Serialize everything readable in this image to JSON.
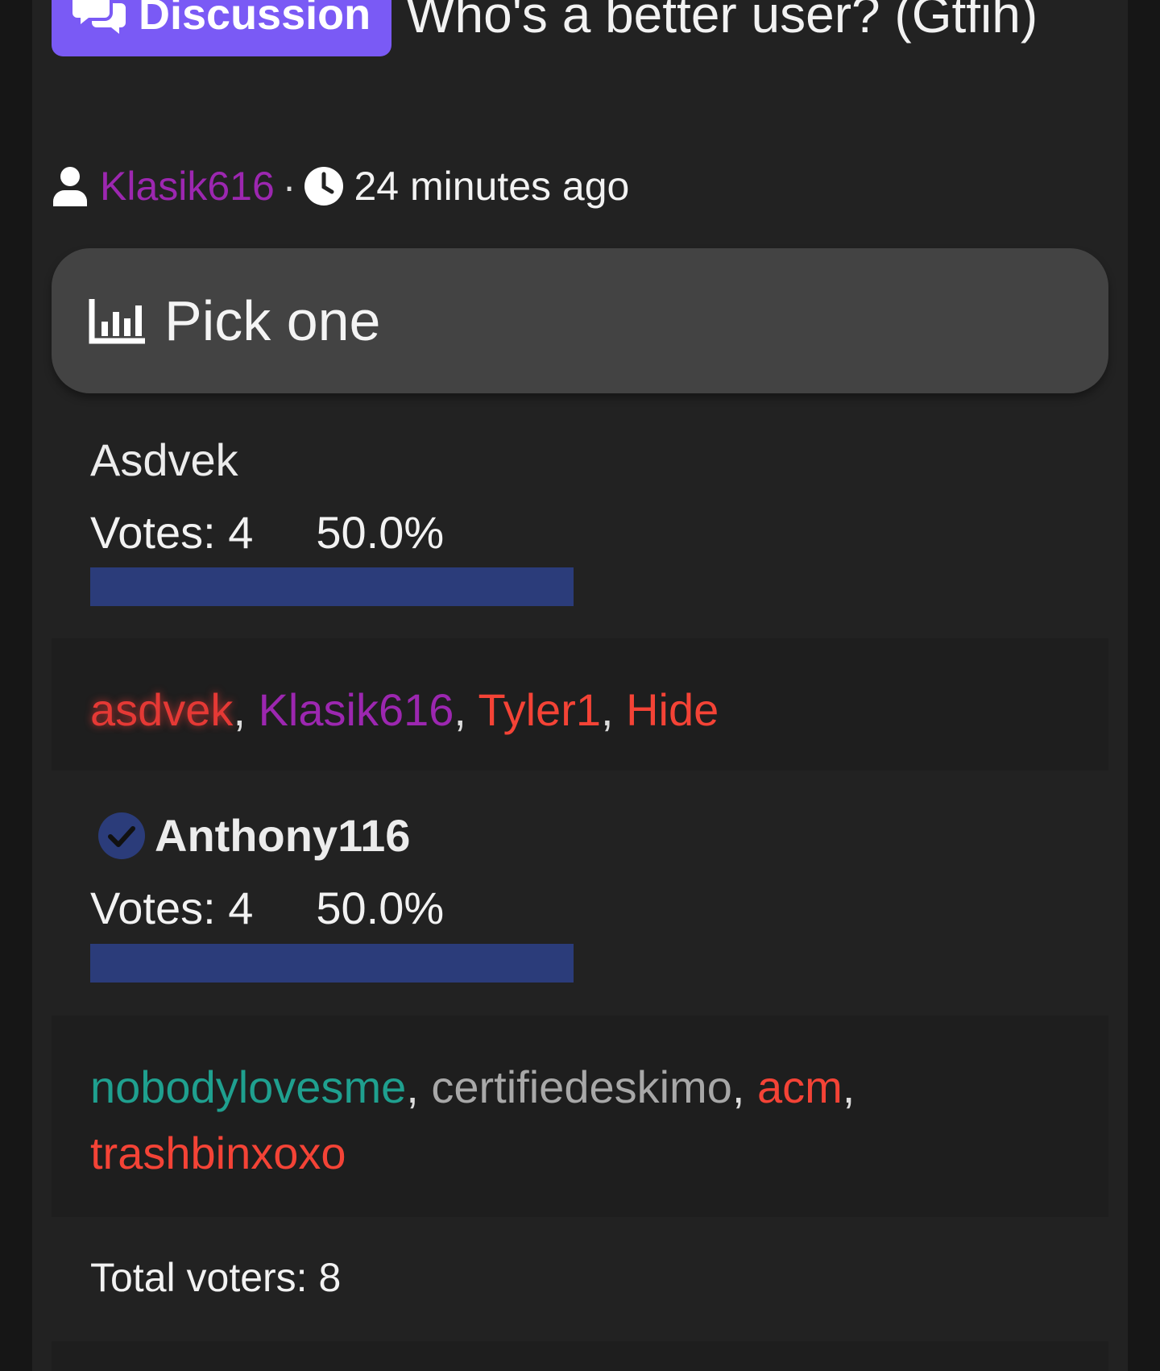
{
  "post": {
    "badge_label": "Discussion",
    "title": "Who's a better user? (Gtfih)",
    "author": "Klasik616",
    "separator": "·",
    "time_ago": "24 minutes ago"
  },
  "poll": {
    "question": "Pick one",
    "options": [
      {
        "name": "Asdvek",
        "votes_label": "Votes: 4",
        "percent_label": "50.0%",
        "fraction": 0.5,
        "voters": [
          {
            "name": "asdvek",
            "color": "#e53935"
          },
          {
            "name": "Klasik616",
            "color": "#9c27b0"
          },
          {
            "name": "Tyler1",
            "color": "#f44336"
          },
          {
            "name": "Hide",
            "color": "#f44336"
          }
        ]
      },
      {
        "name": "Anthony116",
        "votes_label": "Votes: 4",
        "percent_label": "50.0%",
        "fraction": 0.5,
        "selected": true,
        "voters": [
          {
            "name": "nobodylovesme",
            "color": "#1fa08f"
          },
          {
            "name": "certifiedeskimo",
            "color": "#a8a8a8"
          },
          {
            "name": "acm",
            "color": "#f44336"
          },
          {
            "name": "trashbinxoxo",
            "color": "#f44336"
          }
        ]
      }
    ],
    "total_label": "Total voters: 8",
    "bar_color": "#2b3c7a"
  },
  "colors": {
    "badge": "#7a5af5",
    "author": "#9c27b0",
    "check": "#2b3c7a"
  }
}
